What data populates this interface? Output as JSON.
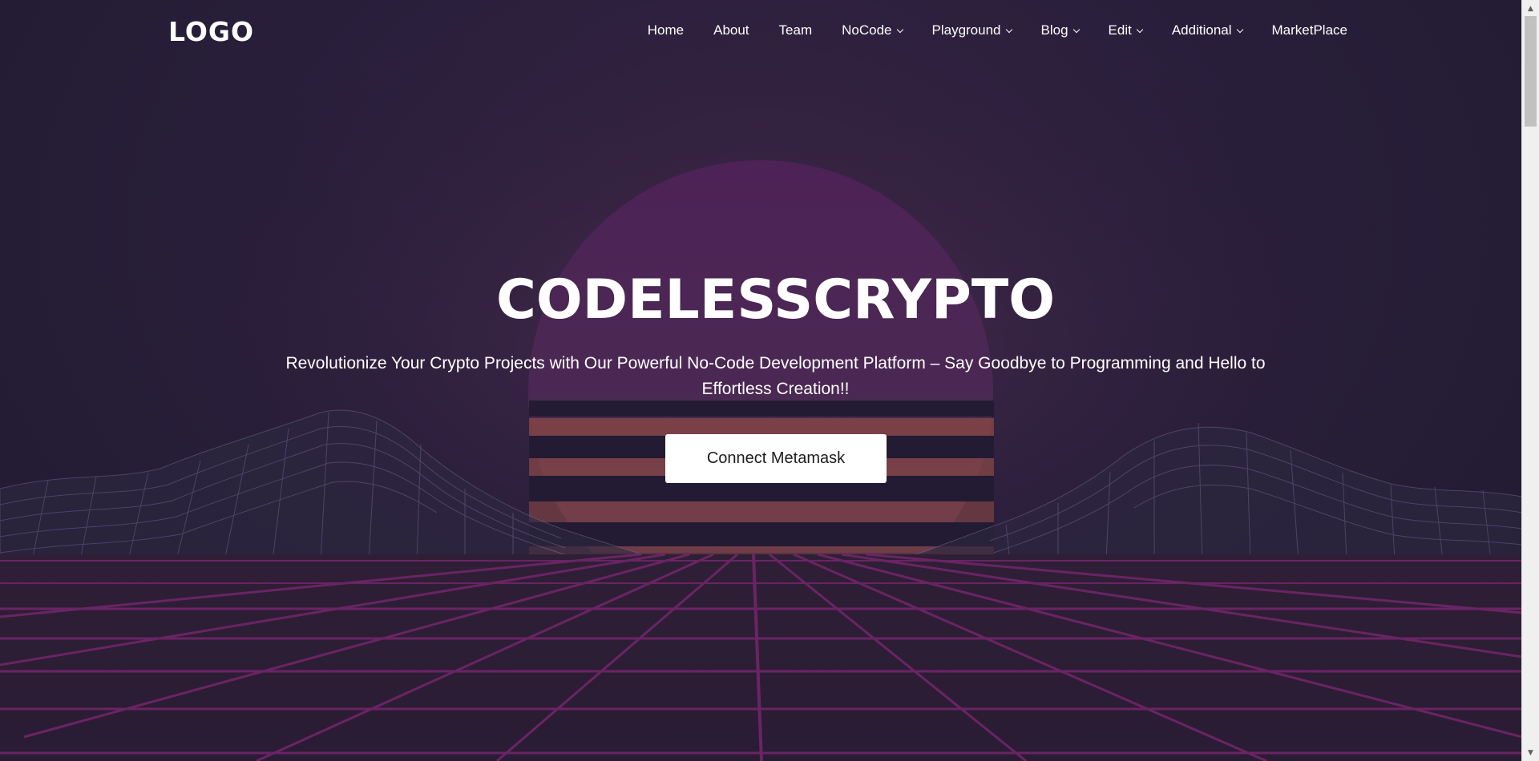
{
  "header": {
    "logo": "LOGO",
    "nav": [
      {
        "label": "Home",
        "dropdown": false
      },
      {
        "label": "About",
        "dropdown": false
      },
      {
        "label": "Team",
        "dropdown": false
      },
      {
        "label": "NoCode",
        "dropdown": true
      },
      {
        "label": "Playground",
        "dropdown": true
      },
      {
        "label": "Blog",
        "dropdown": true
      },
      {
        "label": "Edit",
        "dropdown": true
      },
      {
        "label": "Additional",
        "dropdown": true
      },
      {
        "label": "MarketPlace",
        "dropdown": false
      }
    ]
  },
  "hero": {
    "title": "CODELESSCRYPTO",
    "subtitle_line1": "Revolutionize Your Crypto Projects with Our Powerful No-Code Development Platform – Say Goodbye to Programming and Hello to",
    "subtitle_line2": "Effortless Creation!!",
    "cta_label": "Connect Metamask"
  },
  "colors": {
    "background": "#221b33",
    "sun": "#4a2455",
    "sun_stripes": "#b5583f",
    "grid": "#8a2a7a",
    "wireframe": "#5a4f7a"
  }
}
